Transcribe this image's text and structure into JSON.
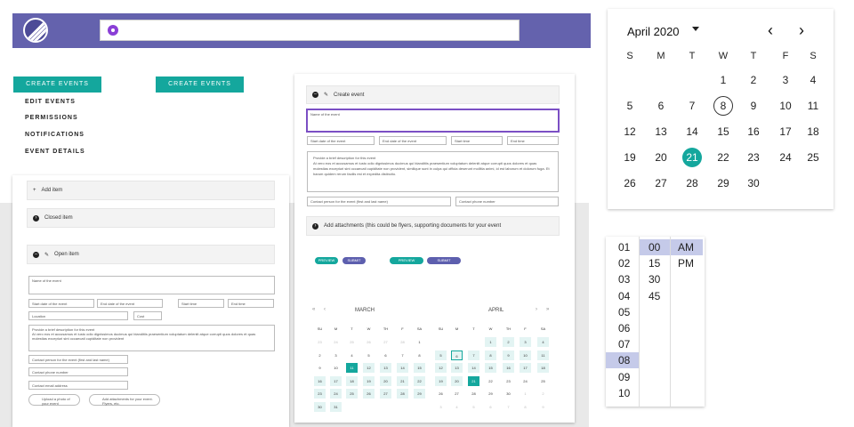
{
  "header": {
    "search_placeholder": ""
  },
  "menu": {
    "create_btn_1": "CREATE EVENTS",
    "create_btn_2": "CREATE EVENTS",
    "items": [
      "EDIT EVENTS",
      "PERMISSIONS",
      "NOTIFICATIONS",
      "EVENT DETAILS"
    ]
  },
  "accordion": {
    "add_item": "Add item",
    "closed_item": "Closed item",
    "open_item": "Open item"
  },
  "left_form": {
    "name": "Name of the event",
    "start_date": "Start date of the event",
    "end_date": "End date of the event",
    "start_time": "Start time",
    "end_time": "End time",
    "location": "Location",
    "cost": "Cost",
    "desc_title": "Provide a brief description for this event",
    "desc_body": "At vero eos et accusamus et iusto odio dignissimos ducimus qui blanditiis praesentium voluptatum deleniti atque corrupti quos dolores et quas molestias excepturi sint occaecati cupiditate non provident",
    "contact_person": "Contact person for the event (first and last name)",
    "contact_phone": "Contact phone number",
    "contact_email": "Contact email address",
    "upload_1": "Upload a photo of your event",
    "upload_2": "Add attachments for your event. Flyers, etc."
  },
  "center_form": {
    "header": "Create event",
    "name": "Name of the event",
    "start_date": "Start date of the event",
    "end_date": "End date of the event",
    "start_time": "Start time",
    "end_time": "End time",
    "desc_title": "Provide a brief description for this event",
    "desc_body": "At vero eos et accusamus et iusto odio dignissimos ducimus qui blanditiis praesentium voluptatum deleniti atque corrupti quos dolores et quas molestias excepturi sint occaecati cupiditate non provident, similique sunt in culpa qui officia deserunt mollitia animi, id est laborum et dolorum fuga. Et harum quidem rerum facilis est et expedita distinctio.",
    "contact_person": "Contact person for the event (first and last name)",
    "contact_phone": "Contact phone number",
    "attachments": "Add attachments (this could be flyers, supporting documents for your event",
    "preview": "PREVIEW",
    "submit": "SUBMIT"
  },
  "mini_calendar": {
    "month1": "MARCH",
    "month2": "APRIL",
    "days": [
      "SU",
      "M",
      "T",
      "W",
      "TH",
      "F",
      "SA"
    ],
    "march": [
      [
        "",
        "",
        "",
        "",
        "",
        "",
        "1"
      ],
      [
        "2",
        "3",
        "4",
        "5",
        "6",
        "7",
        "8"
      ],
      [
        "9",
        "10",
        "11",
        "12",
        "13",
        "14",
        "15"
      ],
      [
        "16",
        "17",
        "18",
        "19",
        "20",
        "21",
        "22"
      ],
      [
        "23",
        "24",
        "25",
        "26",
        "27",
        "28",
        "29"
      ],
      [
        "30",
        "31",
        "",
        "",
        "",
        "",
        ""
      ]
    ],
    "april": [
      [
        "",
        "",
        "",
        "1",
        "2",
        "3",
        "4"
      ],
      [
        "5",
        "6",
        "7",
        "8",
        "9",
        "10",
        "11"
      ],
      [
        "12",
        "13",
        "14",
        "15",
        "16",
        "17",
        "18"
      ],
      [
        "19",
        "20",
        "21",
        "22",
        "23",
        "24",
        "25"
      ],
      [
        "26",
        "27",
        "28",
        "29",
        "30",
        "",
        ""
      ],
      [
        "",
        "",
        "",
        "",
        "",
        "",
        ""
      ]
    ],
    "prev_march": [
      "23",
      "24",
      "25",
      "26",
      "27",
      "28"
    ],
    "next_april": [
      "1",
      "2",
      "3",
      "4",
      "5",
      "6",
      "7",
      "8",
      "9"
    ]
  },
  "calendar": {
    "title": "April 2020",
    "days": [
      "S",
      "M",
      "T",
      "W",
      "T",
      "F",
      "S"
    ],
    "weeks": [
      [
        "",
        "",
        "",
        "1",
        "2",
        "3",
        "4"
      ],
      [
        "5",
        "6",
        "7",
        "8",
        "9",
        "10",
        "11"
      ],
      [
        "12",
        "13",
        "14",
        "15",
        "16",
        "17",
        "18"
      ],
      [
        "19",
        "20",
        "21",
        "22",
        "23",
        "24",
        "25"
      ],
      [
        "26",
        "27",
        "28",
        "29",
        "30",
        "",
        ""
      ]
    ],
    "today": "8",
    "selected": "21",
    "accent": "#14a79d"
  },
  "time_picker": {
    "hours": [
      "01",
      "02",
      "03",
      "04",
      "05",
      "06",
      "07",
      "08",
      "09",
      "10"
    ],
    "minutes": [
      "00",
      "15",
      "30",
      "45"
    ],
    "periods": [
      "AM",
      "PM"
    ],
    "selected_hour": "08",
    "selected_minute": "00",
    "selected_period": "AM",
    "highlight": "#c5cae9"
  }
}
